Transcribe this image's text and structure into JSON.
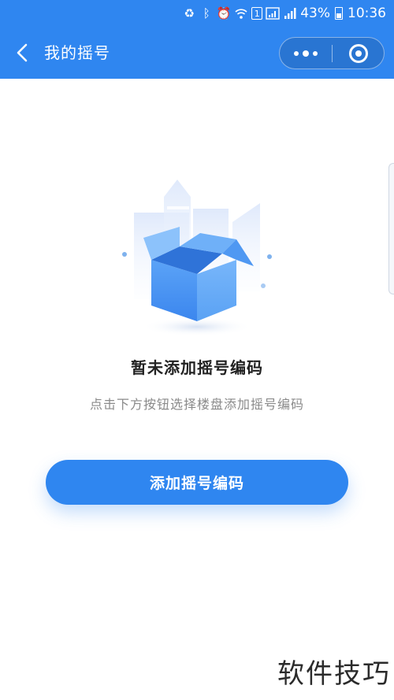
{
  "status_bar": {
    "battery": "43%",
    "time": "10:36",
    "sim_label": "1"
  },
  "nav": {
    "title": "我的摇号"
  },
  "empty_state": {
    "title": "暂未添加摇号编码",
    "subtitle": "点击下方按钮选择楼盘添加摇号编码"
  },
  "actions": {
    "add_label": "添加摇号编码"
  },
  "watermark": {
    "text": "软件技巧"
  },
  "colors": {
    "primary": "#2f86f0"
  }
}
